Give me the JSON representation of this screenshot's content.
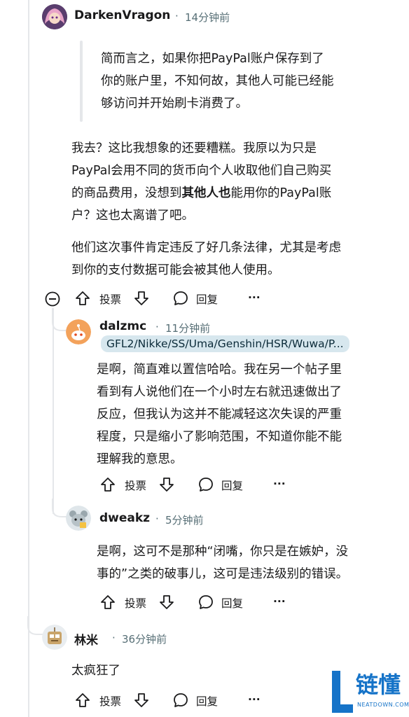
{
  "comments": [
    {
      "username": "DarkenVragon",
      "time": "14分钟前",
      "quote": [
        "简而言之，如果你把PayPal账户保存到了",
        "你的账户里，不知何故，其他人可能已经能",
        "够访问并开始刷卡消费了。"
      ],
      "para1": {
        "line1": "我去？这比我想象的还要糟糕。我原以为只是",
        "line2": "PayPal会用不同的货币向个人收取他们自己购买",
        "line3_a": "的商品费用，没想到",
        "line3_bold": "其他人也",
        "line3_b": "能用你的PayPal账",
        "line4": "户？这也太离谱了吧。"
      },
      "para2": [
        "他们这次事件肯定违反了好几条法律，尤其是考虑",
        "到你的支付数据可能会被其他人使用。"
      ],
      "vote_label": "投票",
      "reply_label": "回复",
      "more": "···"
    },
    {
      "username": "dalzmc",
      "time": "11分钟前",
      "flair": "GFL2/Nikke/SS/Uma/Genshin/HSR/Wuwa/P...",
      "body": [
        "是啊，简直难以置信哈哈。我在另一个帖子里",
        "看到有人说他们在一个小时左右就迅速做出了",
        "反应，但我认为这并不能减轻这次失误的严重",
        "程度，只是缩小了影响范围，不知道你能不能",
        "理解我的意思。"
      ],
      "vote_label": "投票",
      "reply_label": "回复",
      "more": "···"
    },
    {
      "username": "dweakz",
      "time": "5分钟前",
      "body": [
        "是啊，这可不是那种“闭嘴，你只是在嫉妒，没",
        "事的”之类的破事儿，这可是违法级别的错误。"
      ],
      "vote_label": "投票",
      "reply_label": "回复",
      "more": "···"
    },
    {
      "username": "林米",
      "time": "36分钟前",
      "body": [
        "太疯狂了"
      ],
      "vote_label": "投票",
      "reply_label": "回复",
      "more": "···"
    }
  ],
  "separator": "·",
  "watermark": {
    "big": "链懂",
    "small": "NEATDOWN.COM"
  },
  "colors": {
    "flair_bg": "#d7e7ee",
    "meta": "#576f76",
    "thread": "#e5e7ea",
    "logo_blue": "#1573c8"
  }
}
